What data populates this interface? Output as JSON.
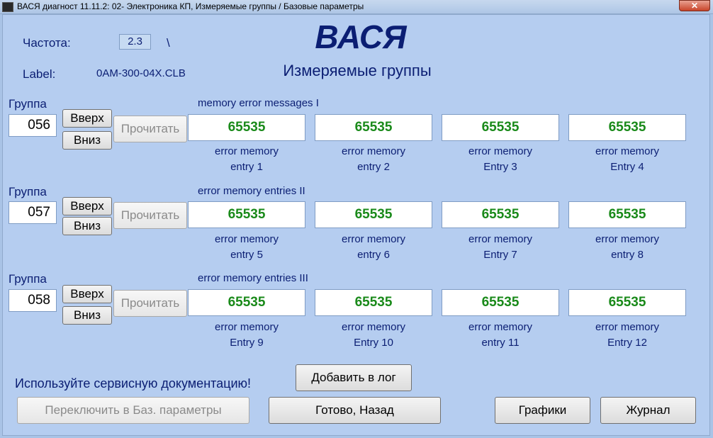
{
  "window": {
    "title": "ВАСЯ диагност 11.11.2: 02- Электроника КП,  Измеряемые группы / Базовые параметры",
    "close_glyph": "✕"
  },
  "header": {
    "freq_label": "Частота:",
    "freq_value": "2.3",
    "freq_extra": "\\",
    "label_label": "Label:",
    "label_value": "0AM-300-04X.CLB",
    "app_title": "ВАСЯ",
    "subtitle": "Измеряемые группы"
  },
  "groups": [
    {
      "label": "Группа",
      "number": "056",
      "up": "Вверх",
      "down": "Вниз",
      "read": "Прочитать",
      "title": "memory error messages I",
      "cells": [
        {
          "value": "65535",
          "line1": "error memory",
          "line2": "entry 1"
        },
        {
          "value": "65535",
          "line1": "error memory",
          "line2": "entry 2"
        },
        {
          "value": "65535",
          "line1": "error memory",
          "line2": "Entry 3"
        },
        {
          "value": "65535",
          "line1": "error memory",
          "line2": "Entry 4"
        }
      ]
    },
    {
      "label": "Группа",
      "number": "057",
      "up": "Вверх",
      "down": "Вниз",
      "read": "Прочитать",
      "title": "error memory entries II",
      "cells": [
        {
          "value": "65535",
          "line1": "error memory",
          "line2": "entry 5"
        },
        {
          "value": "65535",
          "line1": "error memory",
          "line2": "entry 6"
        },
        {
          "value": "65535",
          "line1": "error memory",
          "line2": "Entry 7"
        },
        {
          "value": "65535",
          "line1": "error memory",
          "line2": "entry 8"
        }
      ]
    },
    {
      "label": "Группа",
      "number": "058",
      "up": "Вверх",
      "down": "Вниз",
      "read": "Прочитать",
      "title": "error memory entries III",
      "cells": [
        {
          "value": "65535",
          "line1": "error memory",
          "line2": "Entry 9"
        },
        {
          "value": "65535",
          "line1": "error memory",
          "line2": "Entry 10"
        },
        {
          "value": "65535",
          "line1": "error memory",
          "line2": "entry 11"
        },
        {
          "value": "65535",
          "line1": "error memory",
          "line2": "Entry 12"
        }
      ]
    }
  ],
  "footer": {
    "note": "Используйте сервисную документацию!",
    "add_log": "Добавить в лог",
    "switch_basic": "Переключить в Баз. параметры",
    "done_back": "Готово, Назад",
    "graphs": "Графики",
    "journal": "Журнал"
  }
}
